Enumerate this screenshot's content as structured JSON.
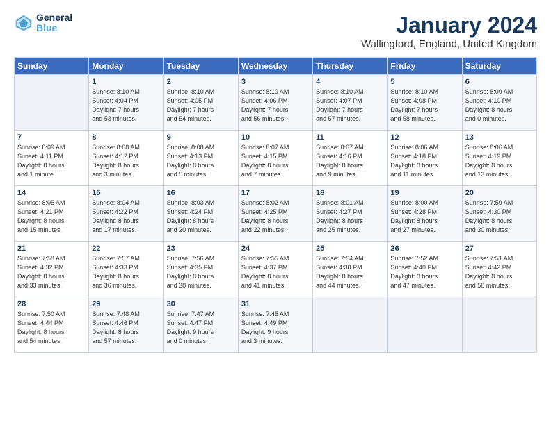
{
  "header": {
    "logo_line1": "General",
    "logo_line2": "Blue",
    "month_title": "January 2024",
    "location": "Wallingford, England, United Kingdom"
  },
  "days_of_week": [
    "Sunday",
    "Monday",
    "Tuesday",
    "Wednesday",
    "Thursday",
    "Friday",
    "Saturday"
  ],
  "weeks": [
    [
      {
        "day": "",
        "info": ""
      },
      {
        "day": "1",
        "info": "Sunrise: 8:10 AM\nSunset: 4:04 PM\nDaylight: 7 hours\nand 53 minutes."
      },
      {
        "day": "2",
        "info": "Sunrise: 8:10 AM\nSunset: 4:05 PM\nDaylight: 7 hours\nand 54 minutes."
      },
      {
        "day": "3",
        "info": "Sunrise: 8:10 AM\nSunset: 4:06 PM\nDaylight: 7 hours\nand 56 minutes."
      },
      {
        "day": "4",
        "info": "Sunrise: 8:10 AM\nSunset: 4:07 PM\nDaylight: 7 hours\nand 57 minutes."
      },
      {
        "day": "5",
        "info": "Sunrise: 8:10 AM\nSunset: 4:08 PM\nDaylight: 7 hours\nand 58 minutes."
      },
      {
        "day": "6",
        "info": "Sunrise: 8:09 AM\nSunset: 4:10 PM\nDaylight: 8 hours\nand 0 minutes."
      }
    ],
    [
      {
        "day": "7",
        "info": "Sunrise: 8:09 AM\nSunset: 4:11 PM\nDaylight: 8 hours\nand 1 minute."
      },
      {
        "day": "8",
        "info": "Sunrise: 8:08 AM\nSunset: 4:12 PM\nDaylight: 8 hours\nand 3 minutes."
      },
      {
        "day": "9",
        "info": "Sunrise: 8:08 AM\nSunset: 4:13 PM\nDaylight: 8 hours\nand 5 minutes."
      },
      {
        "day": "10",
        "info": "Sunrise: 8:07 AM\nSunset: 4:15 PM\nDaylight: 8 hours\nand 7 minutes."
      },
      {
        "day": "11",
        "info": "Sunrise: 8:07 AM\nSunset: 4:16 PM\nDaylight: 8 hours\nand 9 minutes."
      },
      {
        "day": "12",
        "info": "Sunrise: 8:06 AM\nSunset: 4:18 PM\nDaylight: 8 hours\nand 11 minutes."
      },
      {
        "day": "13",
        "info": "Sunrise: 8:06 AM\nSunset: 4:19 PM\nDaylight: 8 hours\nand 13 minutes."
      }
    ],
    [
      {
        "day": "14",
        "info": "Sunrise: 8:05 AM\nSunset: 4:21 PM\nDaylight: 8 hours\nand 15 minutes."
      },
      {
        "day": "15",
        "info": "Sunrise: 8:04 AM\nSunset: 4:22 PM\nDaylight: 8 hours\nand 17 minutes."
      },
      {
        "day": "16",
        "info": "Sunrise: 8:03 AM\nSunset: 4:24 PM\nDaylight: 8 hours\nand 20 minutes."
      },
      {
        "day": "17",
        "info": "Sunrise: 8:02 AM\nSunset: 4:25 PM\nDaylight: 8 hours\nand 22 minutes."
      },
      {
        "day": "18",
        "info": "Sunrise: 8:01 AM\nSunset: 4:27 PM\nDaylight: 8 hours\nand 25 minutes."
      },
      {
        "day": "19",
        "info": "Sunrise: 8:00 AM\nSunset: 4:28 PM\nDaylight: 8 hours\nand 27 minutes."
      },
      {
        "day": "20",
        "info": "Sunrise: 7:59 AM\nSunset: 4:30 PM\nDaylight: 8 hours\nand 30 minutes."
      }
    ],
    [
      {
        "day": "21",
        "info": "Sunrise: 7:58 AM\nSunset: 4:32 PM\nDaylight: 8 hours\nand 33 minutes."
      },
      {
        "day": "22",
        "info": "Sunrise: 7:57 AM\nSunset: 4:33 PM\nDaylight: 8 hours\nand 36 minutes."
      },
      {
        "day": "23",
        "info": "Sunrise: 7:56 AM\nSunset: 4:35 PM\nDaylight: 8 hours\nand 38 minutes."
      },
      {
        "day": "24",
        "info": "Sunrise: 7:55 AM\nSunset: 4:37 PM\nDaylight: 8 hours\nand 41 minutes."
      },
      {
        "day": "25",
        "info": "Sunrise: 7:54 AM\nSunset: 4:38 PM\nDaylight: 8 hours\nand 44 minutes."
      },
      {
        "day": "26",
        "info": "Sunrise: 7:52 AM\nSunset: 4:40 PM\nDaylight: 8 hours\nand 47 minutes."
      },
      {
        "day": "27",
        "info": "Sunrise: 7:51 AM\nSunset: 4:42 PM\nDaylight: 8 hours\nand 50 minutes."
      }
    ],
    [
      {
        "day": "28",
        "info": "Sunrise: 7:50 AM\nSunset: 4:44 PM\nDaylight: 8 hours\nand 54 minutes."
      },
      {
        "day": "29",
        "info": "Sunrise: 7:48 AM\nSunset: 4:46 PM\nDaylight: 8 hours\nand 57 minutes."
      },
      {
        "day": "30",
        "info": "Sunrise: 7:47 AM\nSunset: 4:47 PM\nDaylight: 9 hours\nand 0 minutes."
      },
      {
        "day": "31",
        "info": "Sunrise: 7:45 AM\nSunset: 4:49 PM\nDaylight: 9 hours\nand 3 minutes."
      },
      {
        "day": "",
        "info": ""
      },
      {
        "day": "",
        "info": ""
      },
      {
        "day": "",
        "info": ""
      }
    ]
  ]
}
